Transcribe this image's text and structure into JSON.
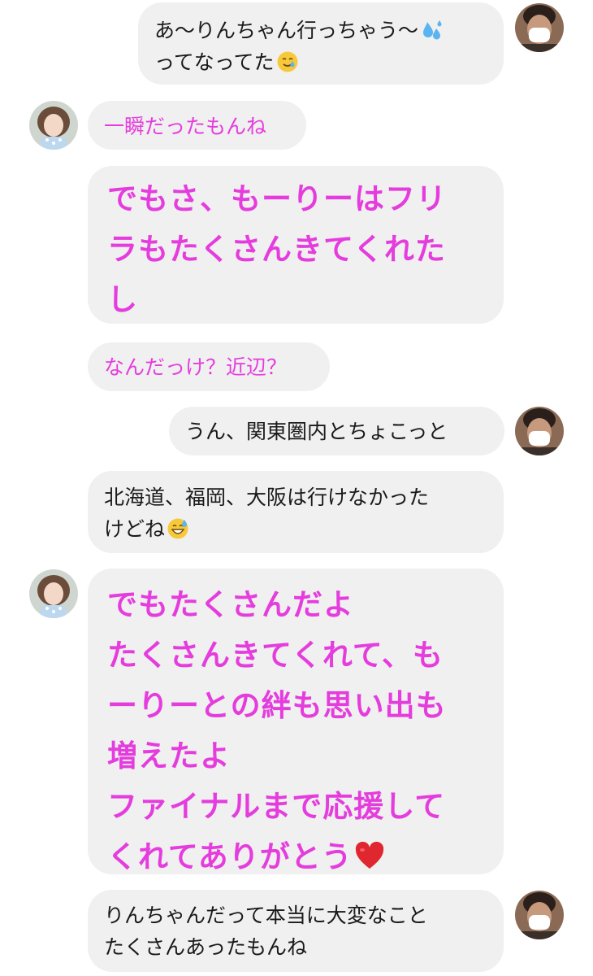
{
  "messages": [
    {
      "sender": "self",
      "text": "あ〜りんちゃん行っちゃう〜",
      "text2": "ってなってた",
      "emoji1": "sweat-droplets",
      "emoji2": "smiling-face-with-tear"
    },
    {
      "sender": "other",
      "text": "一瞬だったもんね"
    },
    {
      "sender": "other",
      "text": "でもさ、もーりーはフリ\nラもたくさんきてくれた\nし"
    },
    {
      "sender": "other",
      "text": "なんだっけ？近辺？"
    },
    {
      "sender": "self",
      "text": "うん、関東圏内とちょこっと"
    },
    {
      "sender": "self",
      "text": "北海道、福岡、大阪は行けなかった\nけどね",
      "emoji": "grinning-face-with-sweat"
    },
    {
      "sender": "other",
      "text": "でもたくさんだよ\nたくさんきてくれて、も\nーりーとの絆も思い出も\n増えたよ\nファイナルまで応援して\nくれてありがとう",
      "emoji": "red-heart"
    },
    {
      "sender": "self",
      "text": "りんちゃんだって本当に大変なこと\nたくさんあったもんね"
    }
  ],
  "colors": {
    "bubble_bg": "#f0f0f0",
    "other_text": "#e53cde",
    "self_text": "#1a1a1a"
  }
}
